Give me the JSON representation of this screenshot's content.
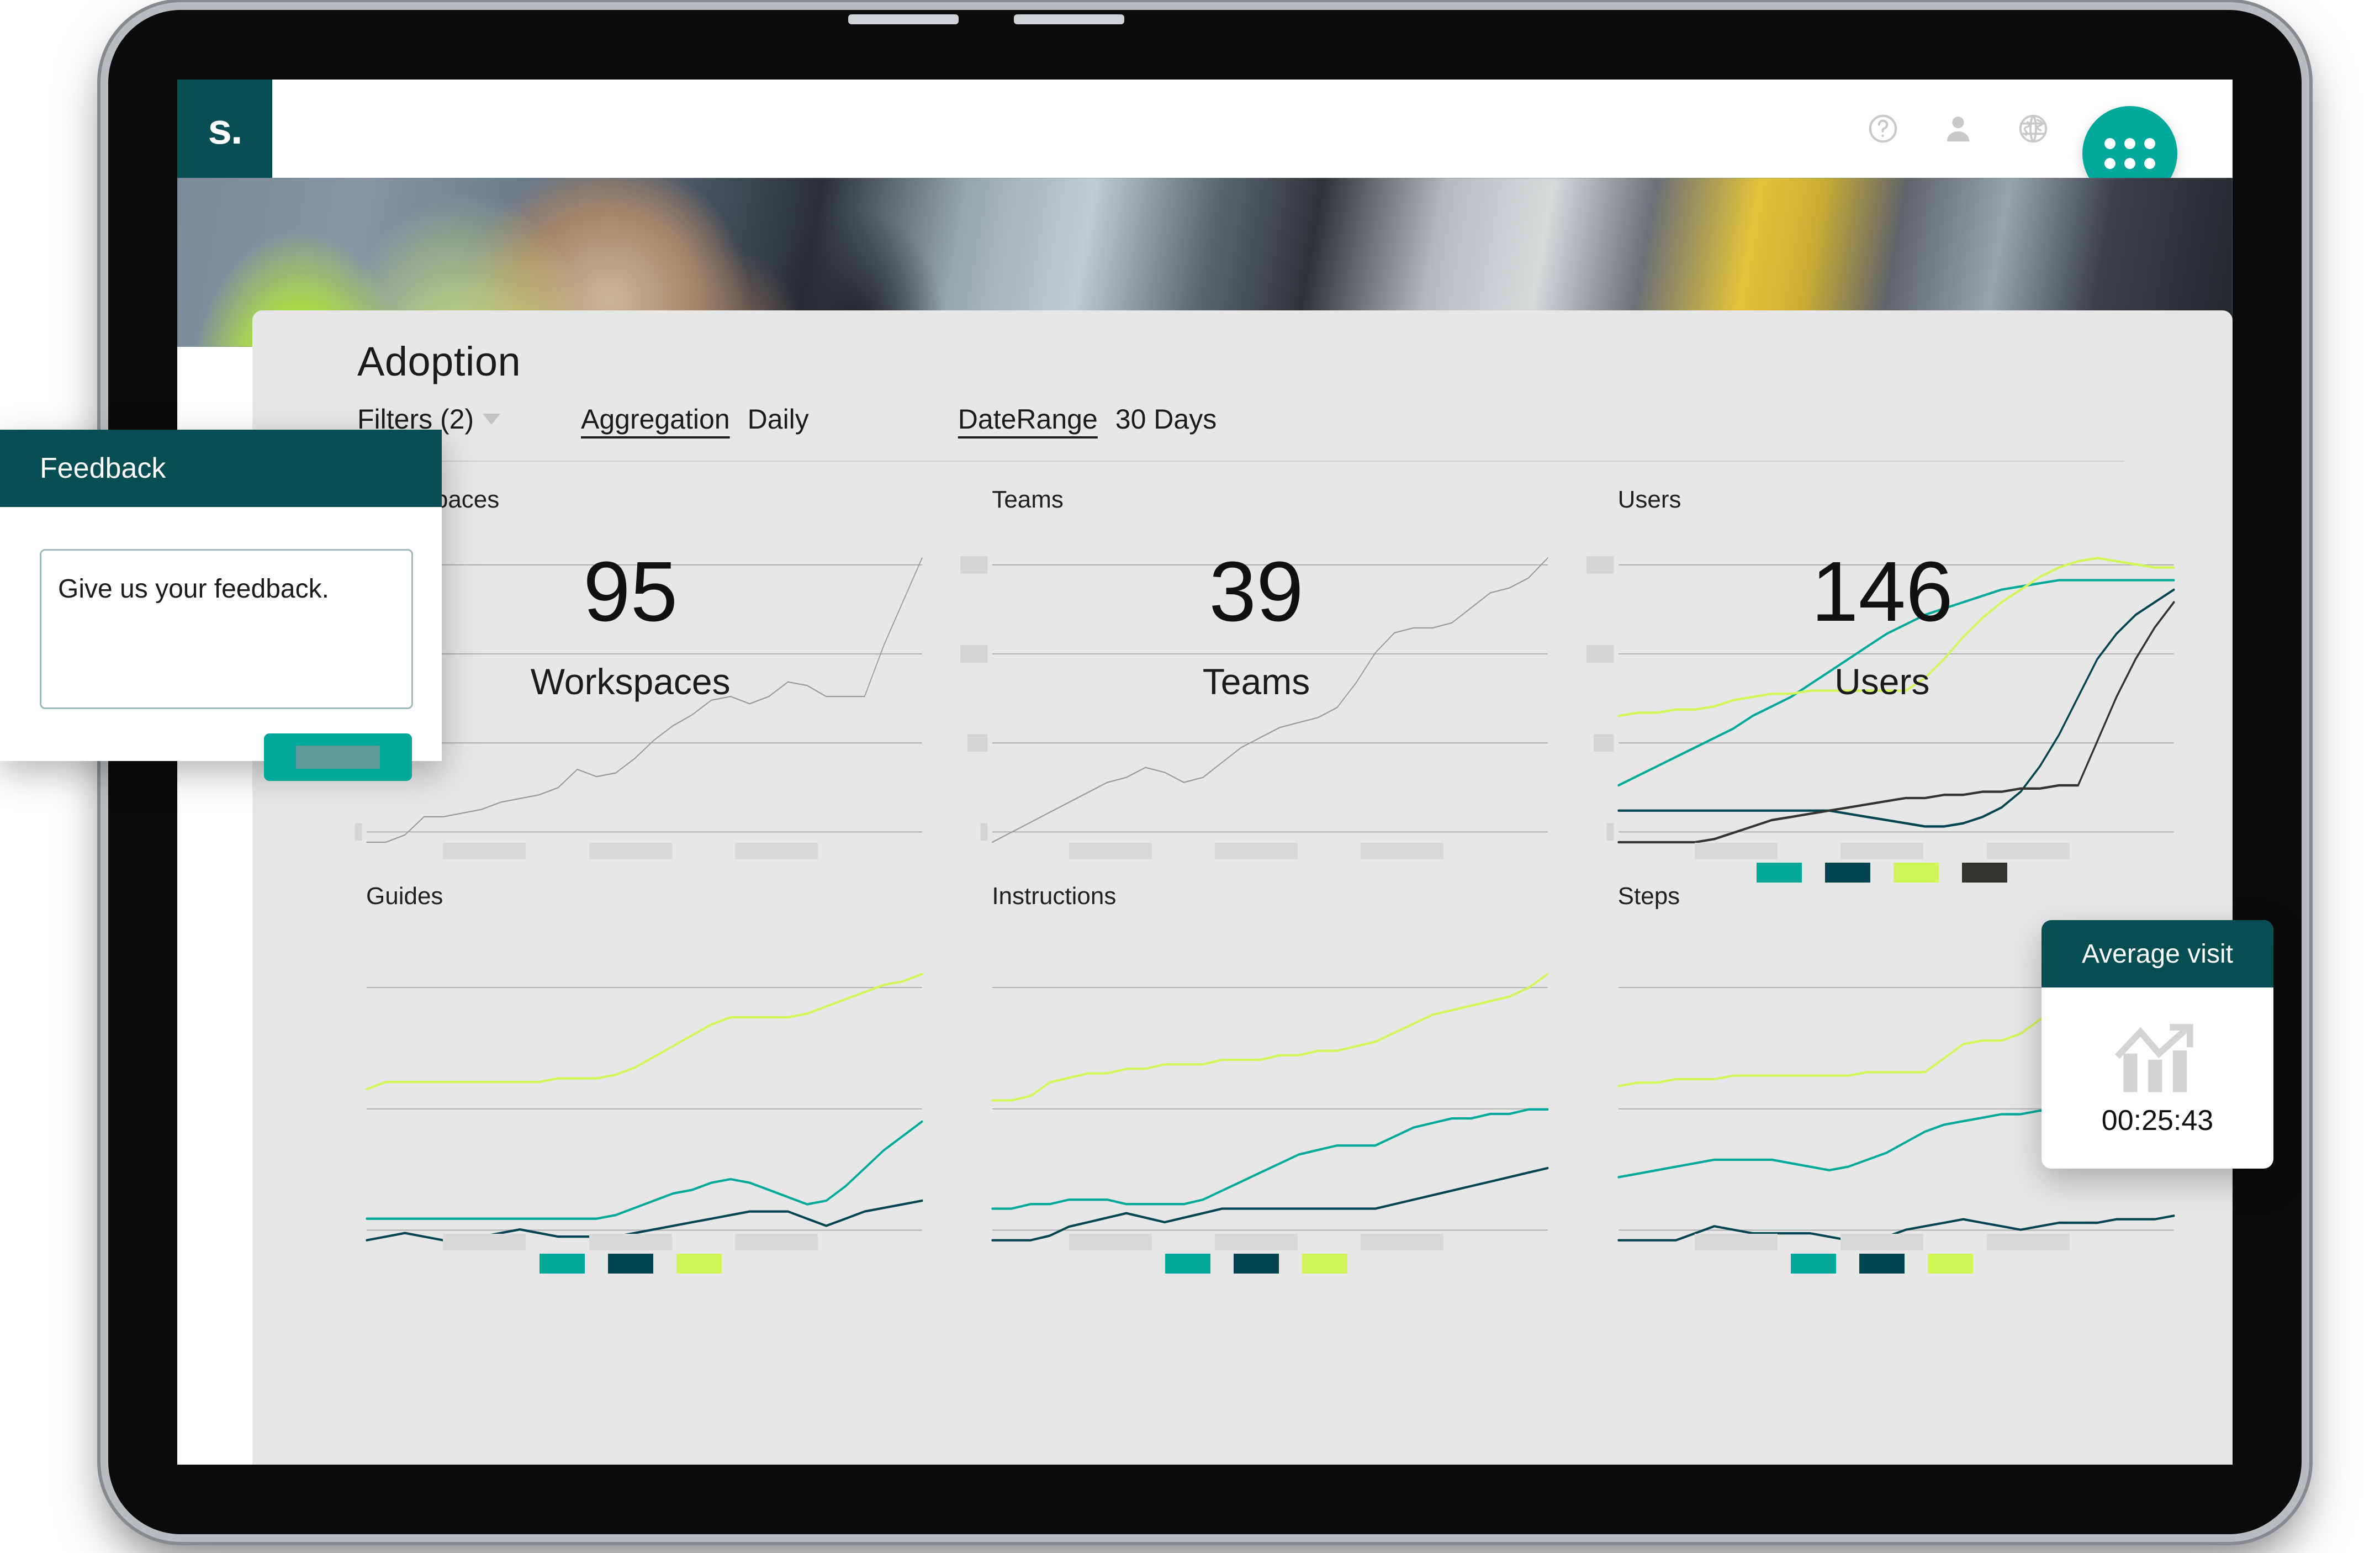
{
  "app": {
    "logo_text": "s.",
    "topbar_icons": [
      {
        "name": "help-icon",
        "glyph": "?"
      },
      {
        "name": "user-icon",
        "glyph": "person"
      },
      {
        "name": "globe-icon",
        "glyph": "globe"
      }
    ],
    "apps_fab": "app-grid"
  },
  "page": {
    "title": "Adoption"
  },
  "toolbar": {
    "filters_label": "Filters (2)",
    "aggregation_key": "Aggregation",
    "aggregation_value": "Daily",
    "daterange_key": "DateRange",
    "daterange_value": "30 Days"
  },
  "feedback": {
    "title": "Feedback",
    "textarea_value": "Give us your feedback.",
    "textarea_placeholder": "Give us your feedback.",
    "submit_label": ""
  },
  "average_visit": {
    "title": "Average visit",
    "value": "00:25:43",
    "icon": "bar-chart-up-arrow-icon"
  },
  "colors": {
    "brand_dark_teal": "#064e54",
    "accent_teal": "#00a99a",
    "series_teal": "#00a99a",
    "series_dark_teal": "#024550",
    "series_lime": "#d2f55a",
    "series_charcoal": "#333330",
    "panel_bg": "#e7e7e7",
    "skeleton": "#d5d5d5",
    "gridline": "#a8a8a8"
  },
  "chart_data": [
    {
      "type": "line",
      "title": "Workspaces",
      "kpi_value": "95",
      "kpi_label": "Workspaces",
      "xlabel": "",
      "ylabel": "",
      "grid": true,
      "legend": [],
      "series": [
        {
          "name": "Workspaces",
          "color": "#9a9a9a",
          "values": [
            18,
            18,
            20,
            25,
            25,
            26,
            27,
            29,
            30,
            31,
            33,
            38,
            36,
            37,
            41,
            46,
            50,
            53,
            57,
            58,
            56,
            58,
            62,
            61,
            58,
            58,
            58,
            72,
            84,
            96
          ]
        }
      ]
    },
    {
      "type": "line",
      "title": "Teams",
      "kpi_value": "39",
      "kpi_label": "Teams",
      "xlabel": "",
      "ylabel": "",
      "grid": true,
      "legend": [],
      "series": [
        {
          "name": "Teams",
          "color": "#9a9a9a",
          "values": [
            20,
            22,
            24,
            26,
            28,
            30,
            32,
            33,
            35,
            34,
            32,
            33,
            36,
            39,
            41,
            43,
            44,
            45,
            47,
            52,
            58,
            62,
            63,
            63,
            64,
            67,
            70,
            71,
            73,
            77
          ]
        }
      ]
    },
    {
      "type": "line",
      "title": "Users",
      "kpi_value": "146",
      "kpi_label": "Users",
      "xlabel": "",
      "ylabel": "",
      "grid": true,
      "legend": [
        {
          "label": "",
          "color": "#00a99a"
        },
        {
          "label": "",
          "color": "#024550"
        },
        {
          "label": "",
          "color": "#d2f55a"
        },
        {
          "label": "",
          "color": "#333330"
        }
      ],
      "series": [
        {
          "name": "series-teal",
          "color": "#00a99a",
          "values": [
            30,
            33,
            36,
            39,
            42,
            45,
            48,
            52,
            55,
            58,
            62,
            66,
            70,
            74,
            78,
            81,
            84,
            86,
            88,
            90,
            92,
            93,
            94,
            95,
            95,
            95,
            95,
            95,
            95,
            95
          ]
        },
        {
          "name": "series-dark-teal",
          "color": "#024550",
          "values": [
            22,
            22,
            22,
            22,
            22,
            22,
            22,
            22,
            22,
            22,
            22,
            22,
            21,
            20,
            19,
            18,
            17,
            17,
            18,
            20,
            23,
            28,
            36,
            46,
            58,
            70,
            78,
            84,
            88,
            92
          ]
        },
        {
          "name": "series-lime",
          "color": "#d2f55a",
          "values": [
            52,
            53,
            53,
            54,
            54,
            55,
            57,
            58,
            59,
            59,
            60,
            60,
            60,
            60,
            60,
            60,
            64,
            70,
            77,
            83,
            88,
            92,
            96,
            99,
            101,
            102,
            101,
            100,
            99,
            99
          ]
        },
        {
          "name": "series-charcoal",
          "color": "#333330",
          "values": [
            12,
            12,
            12,
            12,
            12,
            13,
            15,
            17,
            19,
            20,
            21,
            22,
            23,
            24,
            25,
            26,
            26,
            27,
            27,
            28,
            28,
            29,
            29,
            30,
            30,
            44,
            58,
            70,
            80,
            88
          ]
        }
      ]
    },
    {
      "type": "line",
      "title": "Guides",
      "xlabel": "",
      "ylabel": "",
      "grid": true,
      "legend": [
        {
          "label": "",
          "color": "#00a99a"
        },
        {
          "label": "",
          "color": "#024550"
        },
        {
          "label": "",
          "color": "#d2f55a"
        }
      ],
      "series": [
        {
          "name": "series-lime",
          "color": "#d2f55a",
          "values": [
            56,
            58,
            58,
            58,
            58,
            58,
            58,
            58,
            58,
            58,
            59,
            59,
            59,
            60,
            62,
            65,
            68,
            71,
            74,
            76,
            76,
            76,
            76,
            77,
            79,
            81,
            83,
            85,
            86,
            88
          ]
        },
        {
          "name": "series-teal",
          "color": "#00a99a",
          "values": [
            20,
            20,
            20,
            20,
            20,
            20,
            20,
            20,
            20,
            20,
            20,
            20,
            20,
            21,
            23,
            25,
            27,
            28,
            30,
            31,
            30,
            28,
            26,
            24,
            25,
            29,
            34,
            39,
            43,
            47
          ]
        },
        {
          "name": "series-dark-teal",
          "color": "#024550",
          "values": [
            14,
            15,
            16,
            15,
            14,
            14,
            15,
            16,
            17,
            16,
            15,
            15,
            15,
            15,
            16,
            17,
            18,
            19,
            20,
            21,
            22,
            22,
            22,
            20,
            18,
            20,
            22,
            23,
            24,
            25
          ]
        }
      ]
    },
    {
      "type": "line",
      "title": "Instructions",
      "xlabel": "",
      "ylabel": "",
      "grid": true,
      "legend": [
        {
          "label": "",
          "color": "#00a99a"
        },
        {
          "label": "",
          "color": "#024550"
        },
        {
          "label": "",
          "color": "#d2f55a"
        }
      ],
      "series": [
        {
          "name": "series-lime",
          "color": "#d2f55a",
          "values": [
            36,
            36,
            37,
            40,
            41,
            42,
            42,
            43,
            43,
            44,
            44,
            44,
            45,
            45,
            45,
            46,
            46,
            47,
            47,
            48,
            49,
            51,
            53,
            55,
            56,
            57,
            58,
            59,
            61,
            64
          ]
        },
        {
          "name": "series-teal",
          "color": "#00a99a",
          "values": [
            12,
            12,
            13,
            13,
            14,
            14,
            14,
            13,
            13,
            13,
            13,
            14,
            16,
            18,
            20,
            22,
            24,
            25,
            26,
            26,
            26,
            28,
            30,
            31,
            32,
            32,
            33,
            33,
            34,
            34
          ]
        },
        {
          "name": "series-dark-teal",
          "color": "#024550",
          "values": [
            5,
            5,
            5,
            6,
            8,
            9,
            10,
            11,
            10,
            9,
            10,
            11,
            12,
            12,
            12,
            12,
            12,
            12,
            12,
            12,
            12,
            13,
            14,
            15,
            16,
            17,
            18,
            19,
            20,
            21
          ]
        }
      ]
    },
    {
      "type": "line",
      "title": "Steps",
      "xlabel": "",
      "ylabel": "",
      "grid": true,
      "legend": [
        {
          "label": "",
          "color": "#00a99a"
        },
        {
          "label": "",
          "color": "#024550"
        },
        {
          "label": "",
          "color": "#d2f55a"
        }
      ],
      "series": [
        {
          "name": "series-lime",
          "color": "#d2f55a",
          "values": [
            52,
            53,
            53,
            54,
            54,
            54,
            55,
            55,
            55,
            55,
            55,
            55,
            55,
            56,
            56,
            56,
            56,
            60,
            64,
            65,
            65,
            67,
            71,
            74,
            77,
            79,
            80,
            81,
            82,
            84
          ]
        },
        {
          "name": "series-teal",
          "color": "#00a99a",
          "values": [
            26,
            27,
            28,
            29,
            30,
            31,
            31,
            31,
            31,
            30,
            29,
            28,
            29,
            31,
            33,
            36,
            39,
            41,
            42,
            43,
            44,
            44,
            45,
            45,
            46,
            46,
            47,
            48,
            49,
            50
          ]
        },
        {
          "name": "series-dark-teal",
          "color": "#024550",
          "values": [
            8,
            8,
            8,
            8,
            10,
            12,
            11,
            10,
            10,
            10,
            10,
            9,
            8,
            8,
            9,
            11,
            12,
            13,
            14,
            13,
            12,
            11,
            12,
            13,
            13,
            13,
            14,
            14,
            14,
            15
          ]
        }
      ]
    }
  ]
}
